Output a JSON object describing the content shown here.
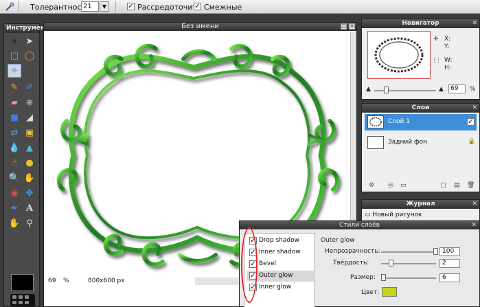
{
  "options_bar": {
    "tool_icon": "magic-wand-icon",
    "tolerance_label": "Толерантность:",
    "tolerance_value": "21",
    "dropdown_glyph": "▼",
    "scatter_label": "Рассредоточить",
    "scatter_checked": true,
    "contiguous_label": "Смежные",
    "contiguous_checked": true
  },
  "tools_panel": {
    "title": "Инструмент",
    "tools": [
      "crop-icon",
      "move-icon",
      "marquee-icon",
      "lasso-icon",
      "magic-wand-icon",
      "pencil-icon",
      "brush-icon",
      "eraser-icon",
      "gradient-icon",
      "clone-stamp-icon",
      "paint-bucket-icon",
      "rectangle-icon",
      "replace-color-icon",
      "smudge-icon",
      "blur-icon",
      "sharpen-icon",
      "dodge-icon",
      "burn-icon",
      "zoom-icon",
      "sponge-icon",
      "red-eye-icon",
      "transform-icon",
      "color-picker-icon",
      "text-icon",
      "hand-icon",
      "magnifier-icon"
    ]
  },
  "document": {
    "title": "Без имени",
    "zoom_value": "69",
    "zoom_unit": "%",
    "dimensions": "800x600 px"
  },
  "navigator": {
    "title": "Навигатор",
    "x_label": "X:",
    "y_label": "Y:",
    "w_label": "W:",
    "h_label": "H:",
    "zoom_value": "69",
    "zoom_unit": "%"
  },
  "layers": {
    "title": "Слои",
    "items": [
      {
        "name": "Слой 1",
        "selected": true,
        "visible": true
      },
      {
        "name": "Задний фон",
        "selected": false,
        "locked": true
      }
    ]
  },
  "history": {
    "title": "Журнал",
    "items": [
      "Новый рисунок"
    ]
  },
  "layer_styles": {
    "title": "Стили слоёв",
    "effects": [
      {
        "name": "Drop shadow",
        "checked": true
      },
      {
        "name": "Inner shadow",
        "checked": true
      },
      {
        "name": "Bevel",
        "checked": true
      },
      {
        "name": "Outer glow",
        "checked": true,
        "selected": true
      },
      {
        "name": "Inner glow",
        "checked": true
      }
    ],
    "section_title": "Outer glow",
    "opacity_label": "Непрозрачность:",
    "opacity_value": "100",
    "hardness_label": "Твёрдость:",
    "hardness_value": "2",
    "size_label": "Размер:",
    "size_value": "6",
    "color_label": "Цвет:",
    "glow_color": "#c8d41e"
  },
  "colors": {
    "ornament_dark": "#1e6b1e",
    "ornament_light": "#6fe03a",
    "highlight": "#e8242c",
    "selected_layer": "#3f8fd8"
  }
}
